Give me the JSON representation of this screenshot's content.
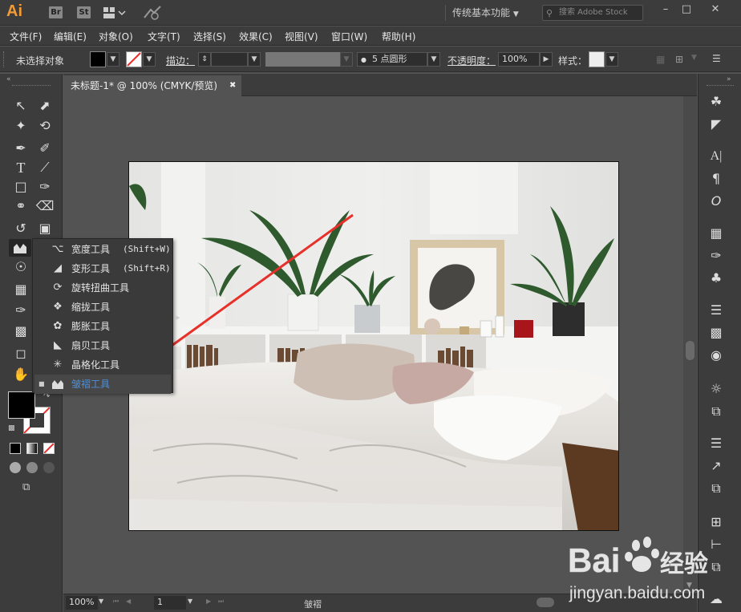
{
  "titlebar": {
    "logo": "Ai",
    "bridge": "Br",
    "stock": "St",
    "workspace": "传统基本功能",
    "search_placeholder": "搜索 Adobe Stock"
  },
  "menubar": {
    "items": [
      "文件(F)",
      "编辑(E)",
      "对象(O)",
      "文字(T)",
      "选择(S)",
      "效果(C)",
      "视图(V)",
      "窗口(W)",
      "帮助(H)"
    ]
  },
  "control": {
    "selection": "未选择对象",
    "stroke_label": "描边：",
    "brush": "5 点圆形",
    "opacity_label": "不透明度：",
    "opacity_value": "100%",
    "style_label": "样式："
  },
  "document": {
    "tab": "未标题-1* @ 100% (CMYK/预览)"
  },
  "flyout": {
    "items": [
      {
        "label": "宽度工具",
        "shortcut": "(Shift+W)",
        "icon": "width-tool-icon"
      },
      {
        "label": "变形工具",
        "shortcut": "(Shift+R)",
        "icon": "warp-tool-icon"
      },
      {
        "label": "旋转扭曲工具",
        "shortcut": "",
        "icon": "twirl-tool-icon"
      },
      {
        "label": "缩拢工具",
        "shortcut": "",
        "icon": "pucker-tool-icon"
      },
      {
        "label": "膨胀工具",
        "shortcut": "",
        "icon": "bloat-tool-icon"
      },
      {
        "label": "扇贝工具",
        "shortcut": "",
        "icon": "scallop-tool-icon"
      },
      {
        "label": "晶格化工具",
        "shortcut": "",
        "icon": "crystallize-tool-icon"
      },
      {
        "label": "皱褶工具",
        "shortcut": "",
        "icon": "wrinkle-tool-icon",
        "selected": true
      }
    ]
  },
  "statusbar": {
    "zoom": "100%",
    "artboard": "1",
    "tool": "皱褶"
  },
  "watermark": {
    "brand": "Bai",
    "brand2": "经验",
    "url": "jingyan.baidu.com"
  },
  "colors": {
    "accent": "#f29b35",
    "highlight": "#4d8fd9",
    "arrow": "#e8302a"
  }
}
